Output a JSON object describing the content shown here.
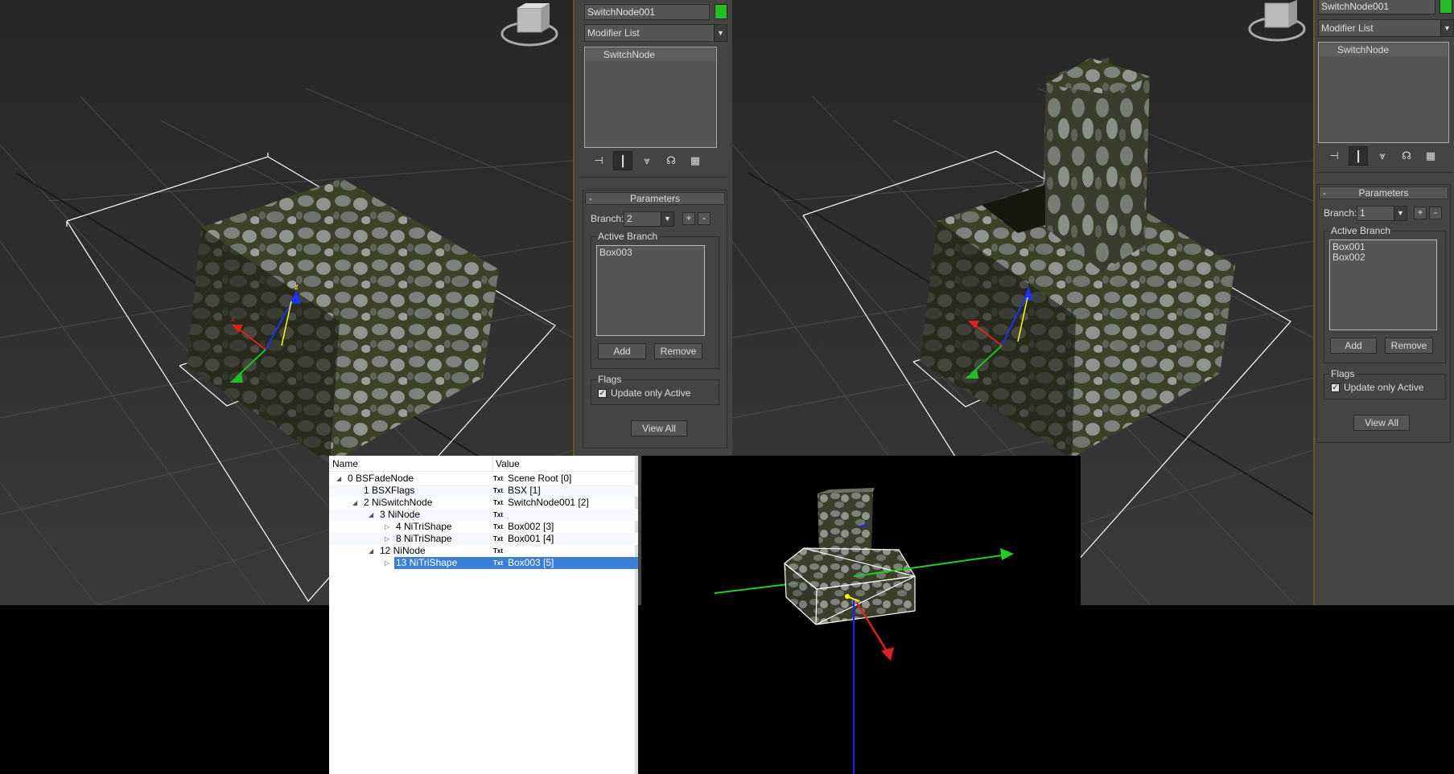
{
  "left_panel": {
    "object_name": "SwitchNode001",
    "modifier_list": "Modifier List",
    "stack_item": "SwitchNode",
    "rollout_title": "Parameters",
    "branch_label": "Branch:",
    "branch_value": "2",
    "plus": "+",
    "minus": "-",
    "collapse": "-",
    "active_branch_title": "Active Branch",
    "active_branch_items": [
      "Box003"
    ],
    "add_label": "Add",
    "remove_label": "Remove",
    "flags_title": "Flags",
    "update_only_active": "Update only Active",
    "view_all": "View All"
  },
  "right_panel": {
    "object_name": "SwitchNode001",
    "modifier_list": "Modifier List",
    "stack_item": "SwitchNode",
    "rollout_title": "Parameters",
    "branch_label": "Branch:",
    "branch_value": "1",
    "plus": "+",
    "minus": "-",
    "collapse": "-",
    "active_branch_title": "Active Branch",
    "active_branch_items": [
      "Box001",
      "Box002"
    ],
    "add_label": "Add",
    "remove_label": "Remove",
    "flags_title": "Flags",
    "update_only_active": "Update only Active",
    "view_all": "View All"
  },
  "viewport_gizmo": {
    "x": "x",
    "z": "z"
  },
  "tree": {
    "col_name": "Name",
    "col_value": "Value",
    "txt_tag": "Txt",
    "rows": [
      {
        "name": "0 BSFadeNode",
        "value": "Scene Root [0]"
      },
      {
        "name": "1 BSXFlags",
        "value": "BSX [1]"
      },
      {
        "name": "2 NiSwitchNode",
        "value": "SwitchNode001 [2]"
      },
      {
        "name": "3 NiNode",
        "value": ""
      },
      {
        "name": "4 NiTriShape",
        "value": "Box002 [3]"
      },
      {
        "name": "8 NiTriShape",
        "value": "Box001 [4]"
      },
      {
        "name": "12 NiNode",
        "value": ""
      },
      {
        "name": "13 NiTriShape",
        "value": "Box003 [5]"
      }
    ]
  },
  "colors": {
    "selection": "#3c7fd7",
    "object_color": "#22c022",
    "panel_bg": "#444444",
    "viewport_bg": "#2f2f2f"
  }
}
